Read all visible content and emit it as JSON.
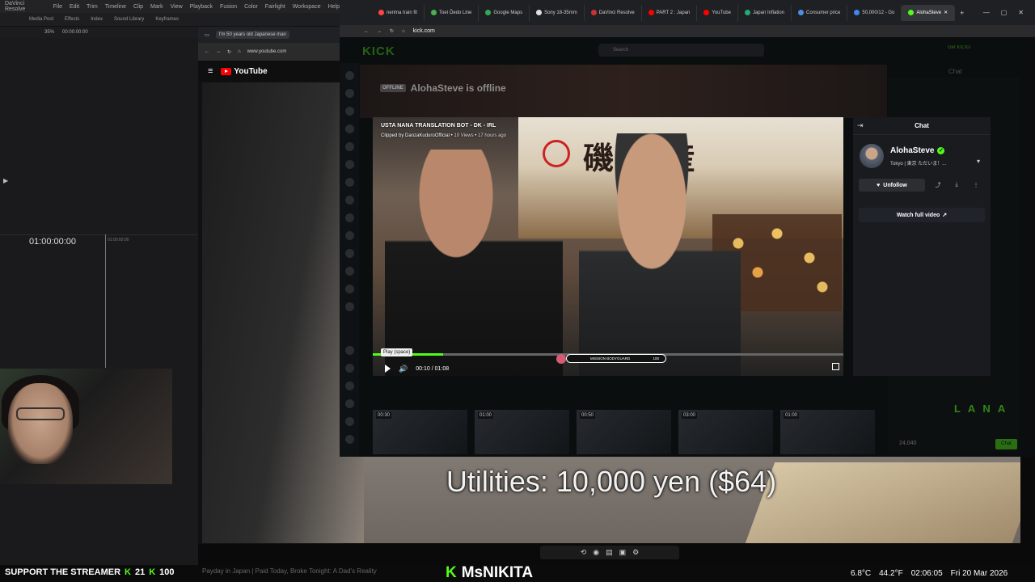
{
  "resolve": {
    "app_name": "DaVinci Resolve",
    "menu": [
      "File",
      "Edit",
      "Trim",
      "Timeline",
      "Clip",
      "Mark",
      "View",
      "Playback",
      "Fusion",
      "Color",
      "Fairlight",
      "Workspace",
      "Help"
    ],
    "toolbar": [
      "Media Pool",
      "Effects",
      "Index",
      "Sound Library",
      "Keyframes"
    ],
    "zoom": "35%",
    "sub_timecode": "00:00:00:00",
    "timecode": "01:00:00:00",
    "ruler_tc": "01:00:00:00"
  },
  "youtube": {
    "tab_title": "I'm 50 years old Japanese man",
    "address": "www.youtube.com",
    "logo": "YouTube",
    "subtitle": "Utilities: 10,000 yen ($64)",
    "bottom_title": "Payday in Japan | Paid Today, Broke Tonight: A Dad's Reality"
  },
  "kick_browser": {
    "tabs": [
      {
        "label": "nerima train fit",
        "color": "#ff4444"
      },
      {
        "label": "Toei Ōedo Line",
        "color": "#4caf50"
      },
      {
        "label": "Google Maps",
        "color": "#34a853"
      },
      {
        "label": "Sony 18-35mm",
        "color": "#e0e0e0"
      },
      {
        "label": "DaVinci Resolve",
        "color": "#c33"
      },
      {
        "label": "PART 2 : Japan",
        "color": "#ff0000"
      },
      {
        "label": "YouTube",
        "color": "#ff0000"
      },
      {
        "label": "Japan Inflation",
        "color": "#2a7"
      },
      {
        "label": "Consumer price",
        "color": "#4a90e2"
      },
      {
        "label": "50,000/12 - Go",
        "color": "#4285f4"
      },
      {
        "label": "AlohaSteve",
        "color": "#53fc18"
      }
    ],
    "address": "kick.com",
    "logo": "KICK",
    "search_placeholder": "Search",
    "get_kicks": "Get KICKs"
  },
  "kick_page": {
    "offline_badge": "OFFLINE",
    "offline_text": "AlohaSteve is offline",
    "bg_chat_label": "Chat",
    "lana": "L A N A",
    "chat_count": "24,040",
    "chat_send": "Chat",
    "thumb_durations": [
      "00:30",
      "01:00",
      "00:50",
      "03:00",
      "01:00"
    ]
  },
  "clip": {
    "title": "USTA NANA TRANSLATION BOT - DK - IRL",
    "clipped_by": "Clipped by DanzaKuduroOfficial",
    "views": "10 Views",
    "age": "17 hours ago",
    "tooltip": "Play (space)",
    "time_current": "00:10",
    "time_total": "01:08",
    "progress_fraction": 0.15,
    "mission_label": "MISSION BODYGUARD",
    "mission_count": "100"
  },
  "chat": {
    "header": "Chat",
    "channel_name": "AlohaSteve",
    "channel_location": "Tokyo | 東京 ただいま！...",
    "unfollow": "Unfollow",
    "watch_full": "Watch full video"
  },
  "overlay": {
    "support_text": "SUPPORT THE STREAMER",
    "support_count_1": "21",
    "support_count_2": "100",
    "streamer_name": "MsNIKITA",
    "temp1": "6.8°C",
    "temp2": "44.2°F",
    "time": "02:06:05",
    "date": "Fri 20 Mar 2026"
  }
}
